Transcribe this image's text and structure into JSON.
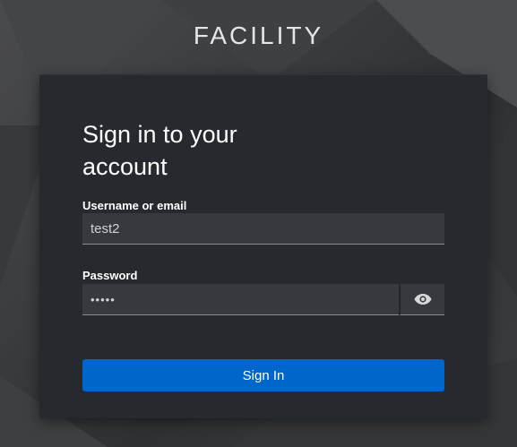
{
  "brand": {
    "name": "FACILITY"
  },
  "login": {
    "title_line1": "Sign in to your",
    "title_line2": "account",
    "username_label": "Username or email",
    "username_value": "test2",
    "password_label": "Password",
    "password_masked": "•••••",
    "signin_label": "Sign In",
    "show_password_icon": "eye-icon"
  },
  "colors": {
    "card_bg": "#26292d",
    "field_bg": "#36393e",
    "primary_button": "#0066cc"
  }
}
